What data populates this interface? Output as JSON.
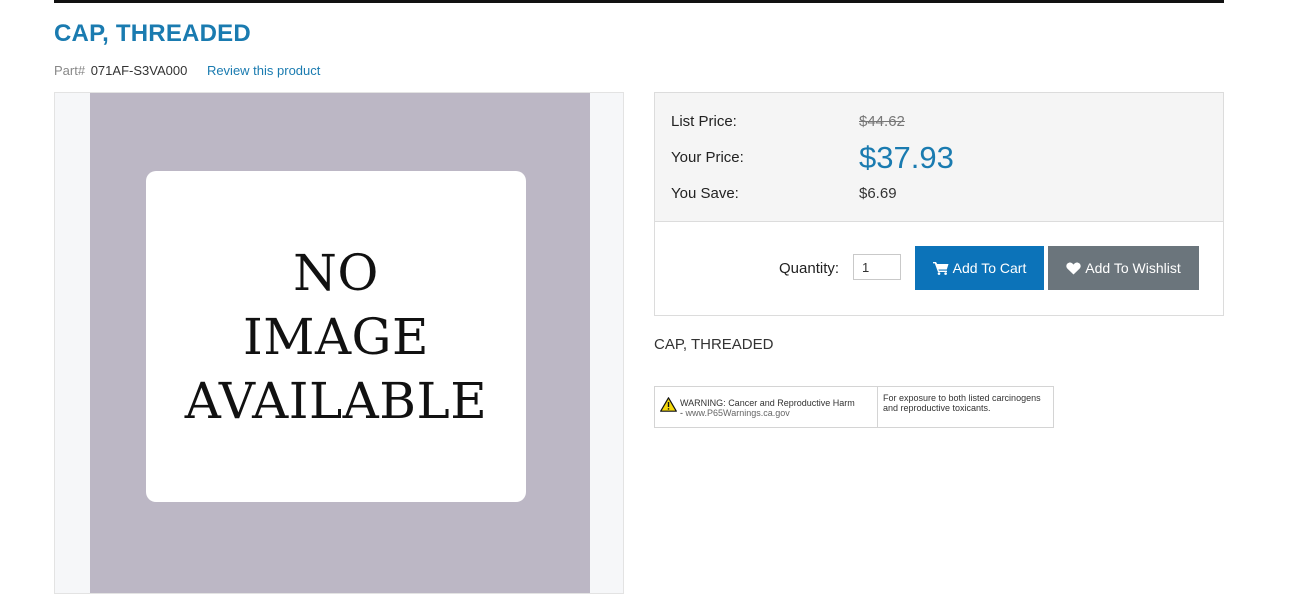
{
  "product": {
    "title": "CAP, THREADED",
    "part_label": "Part#",
    "part_number": "071AF-S3VA000",
    "review_link": "Review this product",
    "short_description": "CAP, THREADED"
  },
  "image": {
    "placeholder_lines": [
      "NO",
      "IMAGE",
      "AVAILABLE"
    ]
  },
  "pricing": {
    "list_price_label": "List Price:",
    "list_price": "$44.62",
    "your_price_label": "Your Price:",
    "your_price": "$37.93",
    "you_save_label": "You Save:",
    "you_save": "$6.69"
  },
  "cart": {
    "quantity_label": "Quantity:",
    "quantity_value": "1",
    "add_to_cart_label": "Add To Cart",
    "add_to_wishlist_label": "Add To Wishlist"
  },
  "warning": {
    "prefix": "WARNING:",
    "text": "Cancer and Reproductive Harm",
    "dash": "-",
    "link": "www.P65Warnings.ca.gov",
    "detail": "For exposure to both listed carcinogens and reproductive toxicants."
  },
  "icons": {
    "cart": "shopping-cart-icon",
    "wishlist": "heart-icon",
    "warning": "warning-triangle-icon"
  },
  "colors": {
    "accent": "#1a7bb0",
    "cart_button": "#0c73b9",
    "wishlist_button": "#6b757c",
    "image_background": "#bcb7c5"
  }
}
